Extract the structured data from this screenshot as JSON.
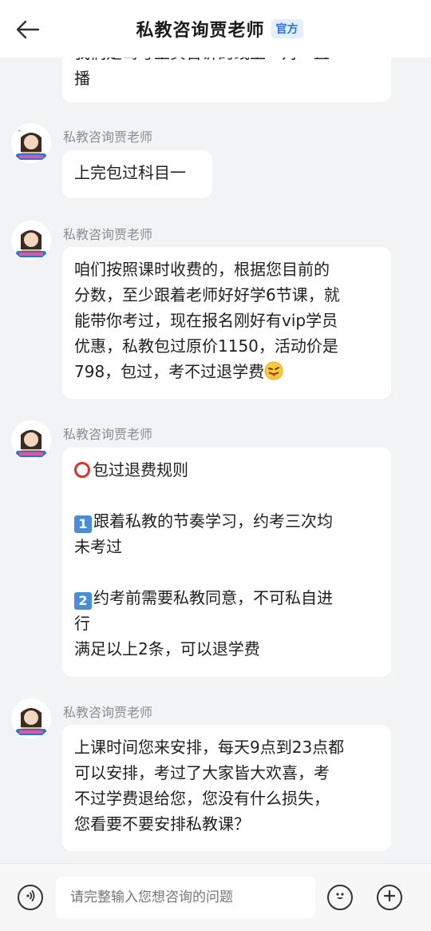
{
  "header": {
    "title": "私教咨询贾老师",
    "badge": "官方"
  },
  "messages": [
    {
      "id": "m0",
      "partial_lines": [
        "我们是驾考主页告诉的线上一对一直",
        "播"
      ]
    },
    {
      "id": "m1",
      "sender": "私教咨询贾老师",
      "lines": [
        "上完包过科目一"
      ]
    },
    {
      "id": "m2",
      "sender": "私教咨询贾老师",
      "lines": [
        "咱们按照课时收费的，根据您目前的",
        "分数，至少跟着老师好好学6节课，就",
        "能带你考过，现在报名刚好有vip学员",
        "优惠，私教包过原价1150，活动价是",
        "798，包过，考不过退学费"
      ],
      "trailing_emoji": "tongue-wink-emoji"
    },
    {
      "id": "m3",
      "sender": "私教咨询贾老师",
      "heading": "包过退费规则",
      "rule1": [
        "跟着私教的节奏学习，约考三次均",
        "未考过"
      ],
      "rule2": [
        "约考前需要私教同意，不可私自进",
        "行"
      ],
      "footer": "满足以上2条，可以退学费",
      "rule1_key": "1",
      "rule2_key": "2"
    },
    {
      "id": "m4",
      "sender": "私教咨询贾老师",
      "lines": [
        "上课时间您来安排，每天9点到23点都",
        "可以安排，考过了大家皆大欢喜，考",
        "不过学费退给您，您没有什么损失，",
        "您看要不要安排私教课？"
      ]
    }
  ],
  "input": {
    "placeholder": "请完整输入您想咨询的问题"
  },
  "icons": {
    "back": "back-arrow-icon",
    "voice": "voice-icon",
    "emoji": "emoji-icon",
    "plus": "plus-icon"
  },
  "colors": {
    "accent": "#2f6fd6",
    "background": "#f2f3f5",
    "bubble": "#ffffff"
  }
}
